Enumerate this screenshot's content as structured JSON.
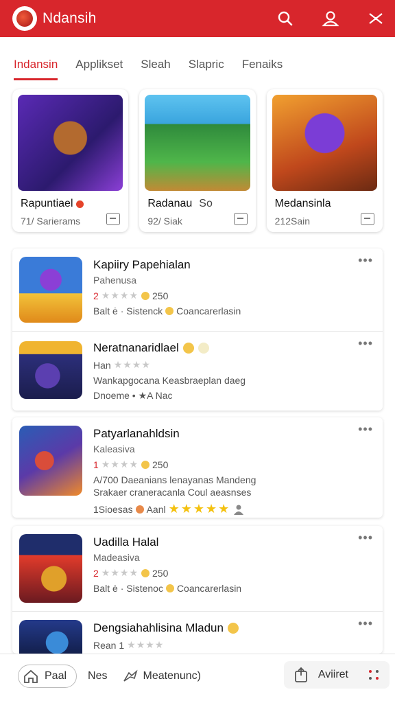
{
  "header": {
    "title": "Ndansih",
    "icons": [
      "search-icon",
      "user-icon",
      "scissors-icon"
    ]
  },
  "tabs": [
    {
      "label": "Indansin",
      "active": true
    },
    {
      "label": "Applikset",
      "active": false
    },
    {
      "label": "Sleah",
      "active": false
    },
    {
      "label": "Slapric",
      "active": false
    },
    {
      "label": "Fenaiks",
      "active": false
    }
  ],
  "featured": [
    {
      "title": "Rapuntiael",
      "subtitle": "71/ Sarierams"
    },
    {
      "title": "Radanau",
      "title_suffix": "So",
      "subtitle": "92/ Siak"
    },
    {
      "title": "Medansinla",
      "subtitle": "212Sain"
    }
  ],
  "list1": [
    {
      "title": "Kapiiry Papehialan",
      "subtitle": "Pahenusa",
      "rating_num": "2",
      "rating_count": "250",
      "meta": "Balt ė · Sistenck",
      "meta2": "Coancarerlasin"
    },
    {
      "title": "Neratnanaridlael",
      "subtitle": "Han",
      "desc": "Wankapgocana Keasbraeplan daeg",
      "meta": "Dnoeme • ★A Nac"
    }
  ],
  "list2": {
    "title": "Patyarlanahldsin",
    "subtitle": "Kaleasiva",
    "rating_num": "1",
    "rating_count": "250",
    "desc1": "A/700 Daeanians lenayanas Mandeng",
    "desc2": "Srakaer craneracanla Coul aeasnses",
    "footer_label": "1Sioesas",
    "footer_name": "Aanl"
  },
  "list3": [
    {
      "title": "Uadilla Halal",
      "subtitle": "Madeasiva",
      "rating_num": "2",
      "rating_count": "250",
      "meta": "Balt ė · Sistenoc",
      "meta2": "Coancarerlasin"
    },
    {
      "title": "Dengsiahahlisina Mladun",
      "subtitle": "Rean 1"
    }
  ],
  "bottom_nav": {
    "home_label": "Paal",
    "item2_label": "Nes",
    "item3_label": "Meatenunc)",
    "right_label": "Aviiret"
  },
  "colors": {
    "brand": "#d8262c",
    "star": "#f4c10f"
  }
}
